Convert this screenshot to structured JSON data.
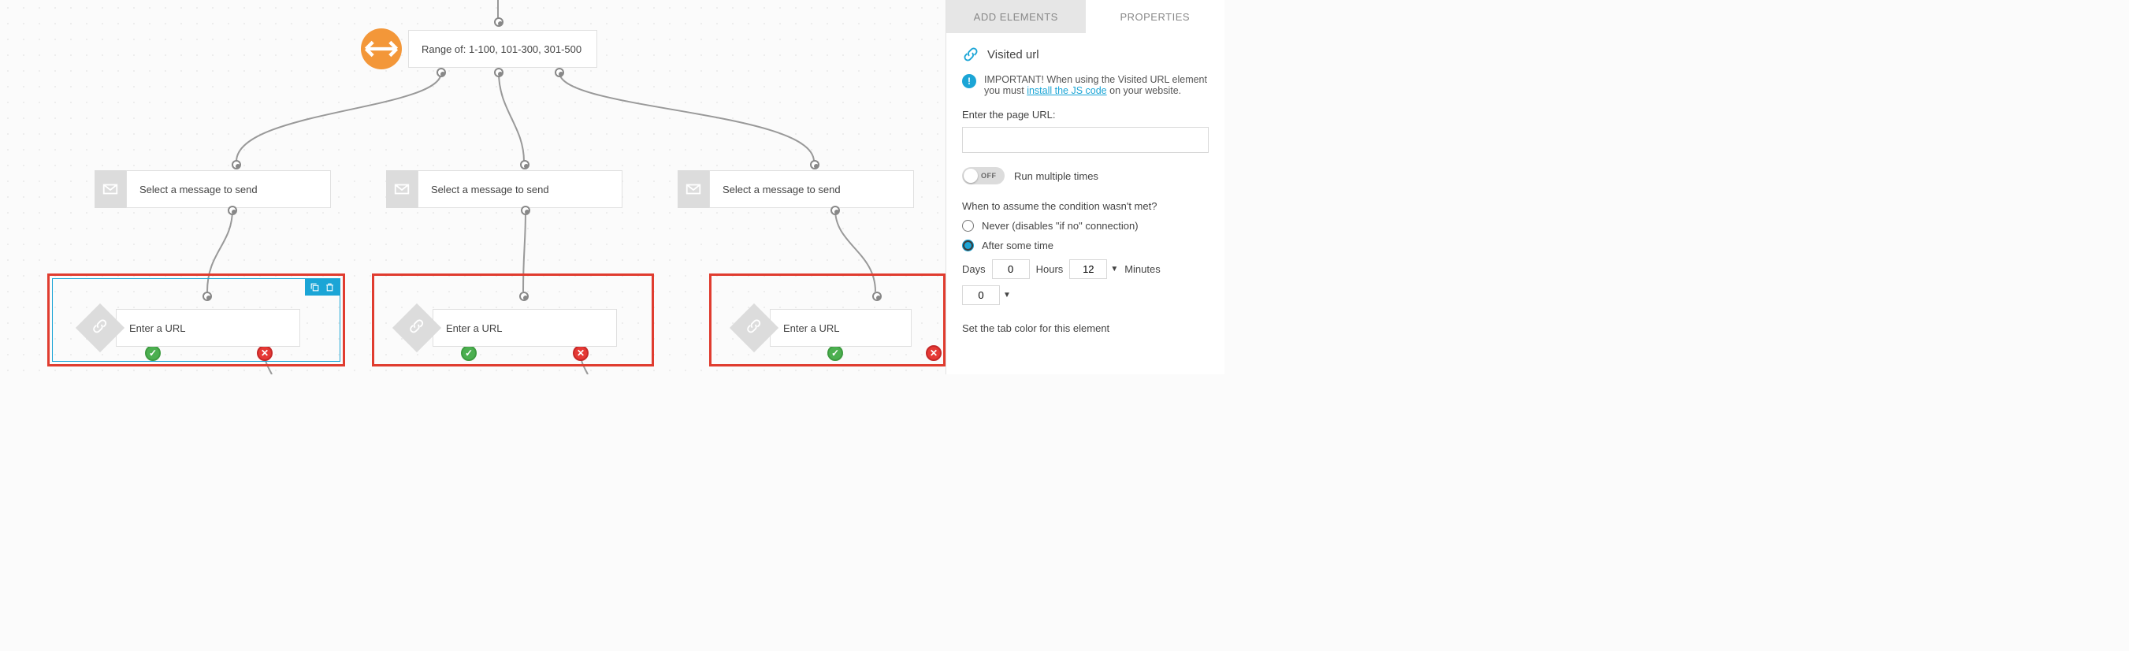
{
  "canvas": {
    "range_node": {
      "label": "Range of: 1-100, 101-300, 301-500"
    },
    "message_nodes": [
      {
        "label": "Select a message to send"
      },
      {
        "label": "Select a message to send"
      },
      {
        "label": "Select a message to send"
      }
    ],
    "url_nodes": [
      {
        "label": "Enter a URL",
        "selected": true
      },
      {
        "label": "Enter a URL",
        "selected": false
      },
      {
        "label": "Enter a URL",
        "selected": false
      }
    ]
  },
  "sidebar": {
    "tabs": {
      "add_elements": "ADD ELEMENTS",
      "properties": "PROPERTIES"
    },
    "panel_title": "Visited url",
    "important_prefix": "IMPORTANT! When using the Visited URL element you must ",
    "important_link": "install the JS code",
    "important_suffix": " on your website.",
    "url_label": "Enter the page URL:",
    "url_value": "",
    "toggle_state": "OFF",
    "toggle_label": "Run multiple times",
    "condition_q": "When to assume the condition wasn't met?",
    "radio_never": "Never (disables \"if no\" connection)",
    "radio_after": "After some time",
    "time": {
      "days_label": "Days",
      "days_value": "0",
      "hours_label": "Hours",
      "hours_value": "12",
      "minutes_label": "Minutes",
      "minutes_value": "0"
    },
    "tab_color_label": "Set the tab color for this element"
  }
}
